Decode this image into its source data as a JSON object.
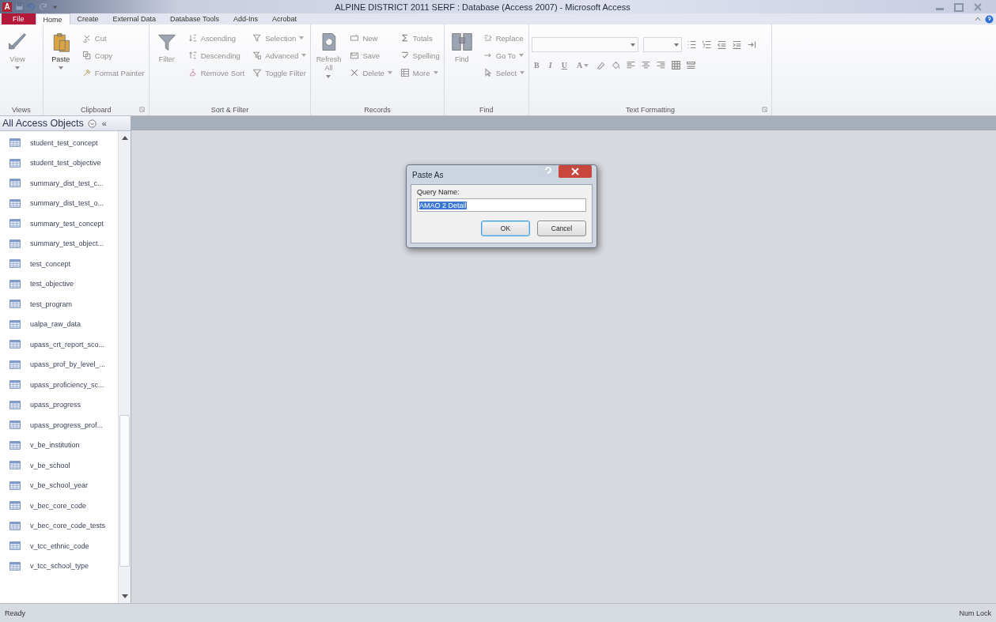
{
  "window": {
    "app_letter": "A",
    "title": "ALPINE DISTRICT 2011 SERF : Database (Access 2007)  -  Microsoft Access"
  },
  "tabs": [
    {
      "label": "File",
      "kind": "file",
      "selected": false
    },
    {
      "label": "Home",
      "kind": "tab",
      "selected": true
    },
    {
      "label": "Create",
      "kind": "tab",
      "selected": false
    },
    {
      "label": "External Data",
      "kind": "tab",
      "selected": false
    },
    {
      "label": "Database Tools",
      "kind": "tab",
      "selected": false
    },
    {
      "label": "Add-Ins",
      "kind": "tab",
      "selected": false
    },
    {
      "label": "Acrobat",
      "kind": "tab",
      "selected": false
    }
  ],
  "ribbon": {
    "groups": [
      {
        "label": "Views",
        "launcher": false,
        "large": [
          {
            "label": "View",
            "disabled": true,
            "dropdown": true
          }
        ]
      },
      {
        "label": "Clipboard",
        "launcher": true,
        "large": [
          {
            "label": "Paste",
            "disabled": false,
            "dropdown": true
          }
        ],
        "columns": [
          [
            {
              "label": "Cut",
              "disabled": true,
              "dropdown": false
            },
            {
              "label": "Copy",
              "disabled": true,
              "dropdown": false
            },
            {
              "label": "Format Painter",
              "disabled": true,
              "dropdown": false
            }
          ]
        ]
      },
      {
        "label": "Sort & Filter",
        "launcher": false,
        "large": [
          {
            "label": "Filter",
            "disabled": true,
            "dropdown": false
          }
        ],
        "columns": [
          [
            {
              "label": "Ascending",
              "disabled": true,
              "dropdown": false
            },
            {
              "label": "Descending",
              "disabled": true,
              "dropdown": false
            },
            {
              "label": "Remove Sort",
              "disabled": true,
              "dropdown": false
            }
          ],
          [
            {
              "label": "Selection",
              "disabled": true,
              "dropdown": true
            },
            {
              "label": "Advanced",
              "disabled": true,
              "dropdown": true
            },
            {
              "label": "Toggle Filter",
              "disabled": true,
              "dropdown": false
            }
          ]
        ]
      },
      {
        "label": "Records",
        "launcher": false,
        "large": [
          {
            "label": "Refresh All",
            "disabled": true,
            "dropdown": true
          }
        ],
        "columns": [
          [
            {
              "label": "New",
              "disabled": true,
              "dropdown": false
            },
            {
              "label": "Save",
              "disabled": true,
              "dropdown": false
            },
            {
              "label": "Delete",
              "disabled": true,
              "dropdown": true
            }
          ],
          [
            {
              "label": "Totals",
              "disabled": true,
              "dropdown": false
            },
            {
              "label": "Spelling",
              "disabled": true,
              "dropdown": false
            },
            {
              "label": "More",
              "disabled": true,
              "dropdown": true
            }
          ]
        ]
      },
      {
        "label": "Find",
        "launcher": false,
        "large": [
          {
            "label": "Find",
            "disabled": true,
            "dropdown": false
          }
        ],
        "columns": [
          [
            {
              "label": "Replace",
              "disabled": true,
              "dropdown": false
            },
            {
              "label": "Go To",
              "disabled": true,
              "dropdown": true
            },
            {
              "label": "Select",
              "disabled": true,
              "dropdown": true
            }
          ]
        ]
      }
    ],
    "text_formatting": {
      "label": "Text Formatting",
      "launcher": true,
      "glyph_buttons": [
        {
          "label": "B",
          "disabled": true,
          "dropdown": false
        },
        {
          "label": "I",
          "disabled": true,
          "dropdown": false
        },
        {
          "label": "U",
          "disabled": true,
          "dropdown": false
        },
        {
          "label": "A",
          "disabled": true,
          "dropdown": true
        }
      ]
    }
  },
  "navigation": {
    "title": "All Access Objects",
    "collapse": "«",
    "items": [
      {
        "label": "student_test_concept"
      },
      {
        "label": "student_test_objective"
      },
      {
        "label": "summary_dist_test_c..."
      },
      {
        "label": "summary_dist_test_o..."
      },
      {
        "label": "summary_test_concept"
      },
      {
        "label": "summary_test_object..."
      },
      {
        "label": "test_concept"
      },
      {
        "label": "test_objective"
      },
      {
        "label": "test_program"
      },
      {
        "label": "ualpa_raw_data"
      },
      {
        "label": "upass_crt_report_sco..."
      },
      {
        "label": "upass_prof_by_level_..."
      },
      {
        "label": "upass_proficiency_sc..."
      },
      {
        "label": "upass_progress"
      },
      {
        "label": "upass_progress_prof..."
      },
      {
        "label": "v_be_institution"
      },
      {
        "label": "v_be_school"
      },
      {
        "label": "v_be_school_year"
      },
      {
        "label": "v_bec_core_code"
      },
      {
        "label": "v_bec_core_code_tests"
      },
      {
        "label": "v_tcc_ethnic_code"
      },
      {
        "label": "v_tcc_school_type"
      }
    ]
  },
  "dialog": {
    "title": "Paste As",
    "field_label": "Query Name:",
    "value": "AMAO 2 Detail",
    "buttons": [
      {
        "label": "OK",
        "kind": "default"
      },
      {
        "label": "Cancel",
        "kind": "normal"
      }
    ]
  },
  "status_bar": {
    "left": "Ready",
    "right": "Num Lock"
  }
}
